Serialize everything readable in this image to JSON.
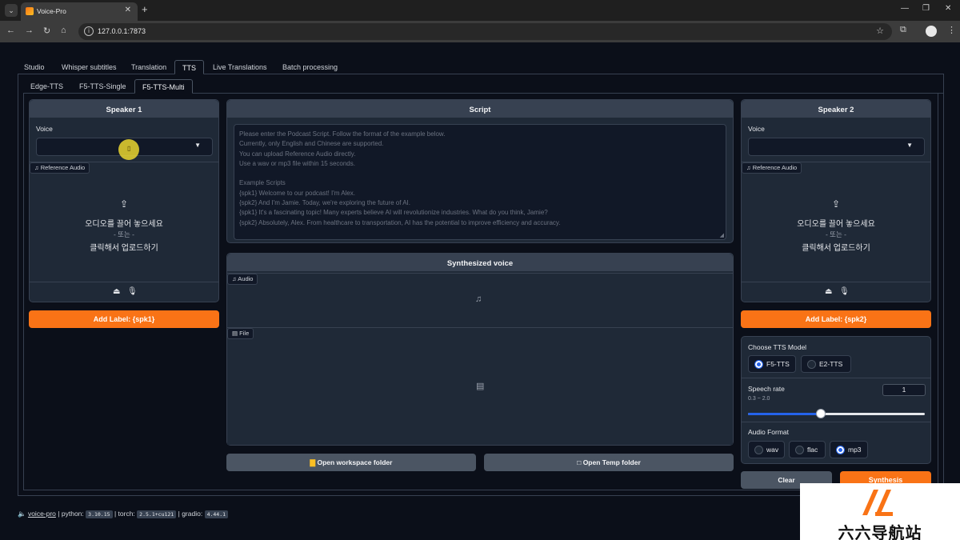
{
  "browser": {
    "tab_title": "Voice-Pro",
    "url": "127.0.0.1:7873"
  },
  "main_tabs": [
    {
      "label": "Studio"
    },
    {
      "label": "Whisper subtitles"
    },
    {
      "label": "Translation"
    },
    {
      "label": "TTS"
    },
    {
      "label": "Live Translations"
    },
    {
      "label": "Batch processing"
    }
  ],
  "sub_tabs": [
    {
      "label": "Edge-TTS"
    },
    {
      "label": "F5-TTS-Single"
    },
    {
      "label": "F5-TTS-Multi"
    }
  ],
  "speaker1": {
    "title": "Speaker 1",
    "voice_label": "Voice",
    "voice_value": "",
    "audio_label": "Reference Audio",
    "upload_drop": "오디오를 끌어 놓으세요",
    "upload_or": "- 또는 -",
    "upload_click": "클릭해서 업로드하기",
    "add_label_button": "Add Label: {spk1}"
  },
  "speaker2": {
    "title": "Speaker 2",
    "voice_label": "Voice",
    "voice_value": "",
    "audio_label": "Reference Audio",
    "upload_drop": "오디오를 끌어 놓으세요",
    "upload_or": "- 또는 -",
    "upload_click": "클릭해서 업로드하기",
    "add_label_button": "Add Label: {spk2}"
  },
  "script": {
    "title": "Script",
    "placeholder_lines": [
      "Please enter the Podcast Script. Follow the format of the example below.",
      "Currently, only English and Chinese are supported.",
      "You can upload Reference Audio directly.",
      "Use a wav or mp3 file within 15 seconds.",
      "",
      "Example Scripts",
      "{spk1} Welcome to our podcast! I'm Alex.",
      "{spk2} And I'm Jamie. Today, we're exploring the future of AI.",
      "{spk1} It's a fascinating topic! Many experts believe AI will revolutionize industries. What do you think, Jamie?",
      "{spk2} Absolutely, Alex. From healthcare to transportation, AI has the potential to improve efficiency and accuracy."
    ]
  },
  "synth": {
    "title": "Synthesized voice",
    "audio_label": "Audio",
    "file_label": "File",
    "open_workspace": "Open workspace folder",
    "open_temp": "Open Temp folder"
  },
  "settings": {
    "model_label": "Choose TTS Model",
    "models": [
      {
        "label": "F5-TTS",
        "checked": true
      },
      {
        "label": "E2-TTS",
        "checked": false
      }
    ],
    "rate_label": "Speech rate",
    "rate_range": "0.3 ~ 2.0",
    "rate_value": "1",
    "rate_min": 0.3,
    "rate_max": 2.0,
    "rate_number": 1,
    "format_label": "Audio Format",
    "formats": [
      {
        "label": "wav",
        "checked": false
      },
      {
        "label": "flac",
        "checked": false
      },
      {
        "label": "mp3",
        "checked": true
      }
    ]
  },
  "actions": {
    "clear": "Clear",
    "synthesis": "Synthesis"
  },
  "footer": {
    "app": "voice-pro",
    "python_label": "python:",
    "python_version": "3.10.15",
    "torch_label": "torch:",
    "torch_version": "2.5.1+cu121",
    "gradio_label": "gradio:",
    "gradio_version": "4.44.1",
    "sep": "|"
  },
  "watermark": {
    "text": "六六导航站"
  },
  "colors": {
    "accent": "#f97316",
    "radio_checked": "#2563eb",
    "background": "#0b0f19",
    "block": "#1f2937"
  }
}
